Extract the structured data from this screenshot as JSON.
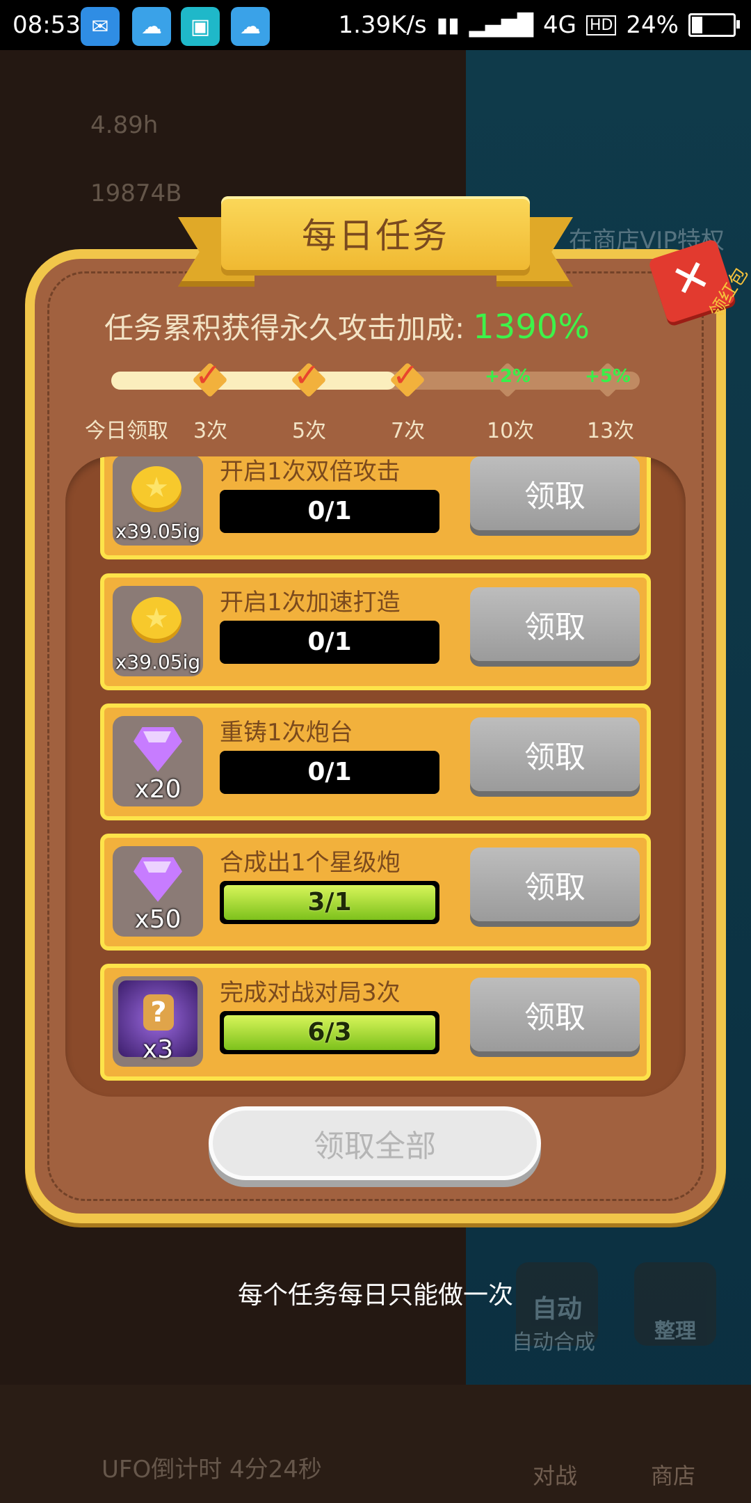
{
  "status_bar": {
    "time": "08:53",
    "net_speed": "1.39K/s",
    "network": "4G",
    "battery": "24%",
    "battery_level": 0.24,
    "icons": [
      "message-icon",
      "weather-icon",
      "scan-icon",
      "weather-icon"
    ]
  },
  "background": {
    "top_left_value": "4.89h",
    "top_left_value2": "19874B",
    "shop_text": "在商店VIP特权",
    "auto_label": "自动",
    "auto_merge": "自动合成",
    "sort": "整理",
    "battle": "对战",
    "shop": "商店",
    "ufo_timer": "UFO倒计时 4分24秒"
  },
  "dialog": {
    "title": "每日任务",
    "close_tag": "领红包",
    "bonus_label": "任务累积获得永久攻击加成:",
    "bonus_value": "1390%",
    "progress": {
      "fill_fraction": 0.54,
      "milestones": [
        {
          "label": "今日领取"
        },
        {
          "label": "3次",
          "done": true
        },
        {
          "label": "5次",
          "done": true
        },
        {
          "label": "7次",
          "done": true
        },
        {
          "label": "10次",
          "bonus": "+2%"
        },
        {
          "label": "13次",
          "bonus": "+5%"
        }
      ]
    },
    "tasks": [
      {
        "name": "开启1次双倍攻击",
        "reward": "x39.05ig",
        "icon": "coin-icon",
        "progress": "0/1",
        "done": false,
        "button": "领取"
      },
      {
        "name": "开启1次加速打造",
        "reward": "x39.05ig",
        "icon": "coin-icon",
        "progress": "0/1",
        "done": false,
        "button": "领取"
      },
      {
        "name": "重铸1次炮台",
        "reward": "x20",
        "icon": "gem-icon",
        "progress": "0/1",
        "done": false,
        "button": "领取"
      },
      {
        "name": "合成出1个星级炮",
        "reward": "x50",
        "icon": "gem-icon",
        "progress": "3/1",
        "done": true,
        "button": "领取"
      },
      {
        "name": "完成对战对局3次",
        "reward": "x3",
        "icon": "puzzle-icon",
        "progress": "6/3",
        "done": true,
        "button": "领取"
      }
    ],
    "claim_all": "领取全部"
  },
  "hint": "每个任务每日只能做一次",
  "colors": {
    "bonus_green": "#3ef24a",
    "panel_gold": "#f1c64a",
    "panel_brown": "#a1613f",
    "task_bg": "#f2b13c",
    "progress_green": "#8fd322"
  }
}
